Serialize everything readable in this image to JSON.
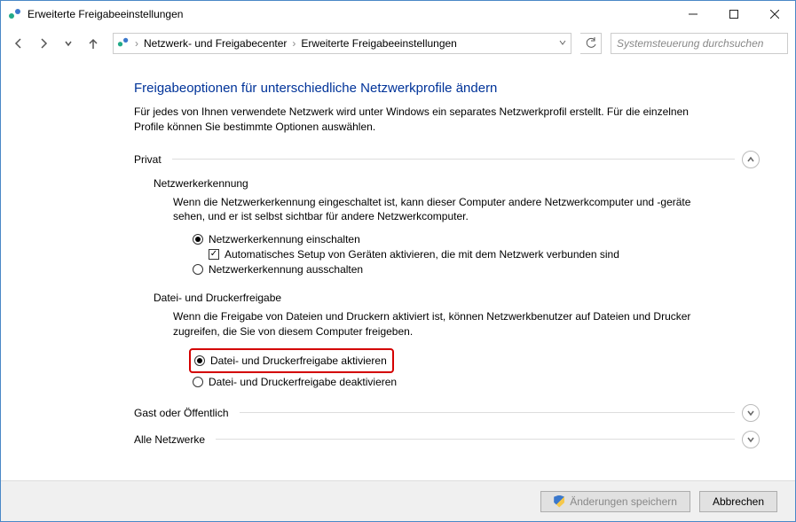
{
  "window": {
    "title": "Erweiterte Freigabeeinstellungen"
  },
  "breadcrumb": {
    "item1": "Netzwerk- und Freigabecenter",
    "item2": "Erweiterte Freigabeeinstellungen"
  },
  "search": {
    "placeholder": "Systemsteuerung durchsuchen"
  },
  "page": {
    "title": "Freigabeoptionen für unterschiedliche Netzwerkprofile ändern",
    "desc": "Für jedes von Ihnen verwendete Netzwerk wird unter Windows ein separates Netzwerkprofil erstellt. Für die einzelnen Profile können Sie bestimmte Optionen auswählen."
  },
  "profiles": {
    "privat": {
      "label": "Privat",
      "discovery": {
        "heading": "Netzwerkerkennung",
        "desc": "Wenn die Netzwerkerkennung eingeschaltet ist, kann dieser Computer andere Netzwerkcomputer und -geräte sehen, und er ist selbst sichtbar für andere Netzwerkcomputer.",
        "opt_on": "Netzwerkerkennung einschalten",
        "opt_auto": "Automatisches Setup von Geräten aktivieren, die mit dem Netzwerk verbunden sind",
        "opt_off": "Netzwerkerkennung ausschalten"
      },
      "sharing": {
        "heading": "Datei- und Druckerfreigabe",
        "desc": "Wenn die Freigabe von Dateien und Druckern aktiviert ist, können Netzwerkbenutzer auf Dateien und Drucker zugreifen, die Sie von diesem Computer freigeben.",
        "opt_on": "Datei- und Druckerfreigabe aktivieren",
        "opt_off": "Datei- und Druckerfreigabe deaktivieren"
      }
    },
    "guest": {
      "label": "Gast oder Öffentlich"
    },
    "all": {
      "label": "Alle Netzwerke"
    }
  },
  "footer": {
    "save": "Änderungen speichern",
    "cancel": "Abbrechen"
  }
}
